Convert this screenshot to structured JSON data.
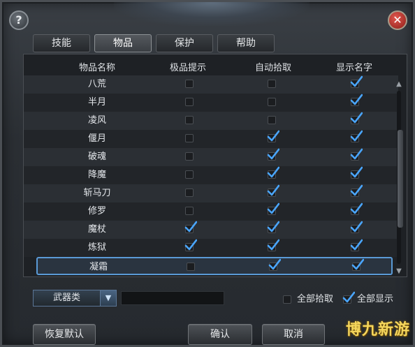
{
  "window": {
    "help_glyph": "?",
    "close_glyph": "✕"
  },
  "tabs": [
    {
      "label": "技能",
      "active": false
    },
    {
      "label": "物品",
      "active": true
    },
    {
      "label": "保护",
      "active": false
    },
    {
      "label": "帮助",
      "active": false
    }
  ],
  "table": {
    "columns": [
      "物品名称",
      "极品提示",
      "自动拾取",
      "显示名字"
    ],
    "rows": [
      {
        "name": "八荒",
        "premium_hint": false,
        "auto_pickup": false,
        "show_name": true
      },
      {
        "name": "半月",
        "premium_hint": false,
        "auto_pickup": false,
        "show_name": true
      },
      {
        "name": "凌风",
        "premium_hint": false,
        "auto_pickup": false,
        "show_name": true
      },
      {
        "name": "偃月",
        "premium_hint": false,
        "auto_pickup": true,
        "show_name": true
      },
      {
        "name": "破魂",
        "premium_hint": false,
        "auto_pickup": true,
        "show_name": true
      },
      {
        "name": "降魔",
        "premium_hint": false,
        "auto_pickup": true,
        "show_name": true
      },
      {
        "name": "斩马刀",
        "premium_hint": false,
        "auto_pickup": true,
        "show_name": true
      },
      {
        "name": "修罗",
        "premium_hint": false,
        "auto_pickup": true,
        "show_name": true
      },
      {
        "name": "魔杖",
        "premium_hint": true,
        "auto_pickup": true,
        "show_name": true
      },
      {
        "name": "炼狱",
        "premium_hint": true,
        "auto_pickup": true,
        "show_name": true
      },
      {
        "name": "凝霜",
        "premium_hint": false,
        "auto_pickup": true,
        "show_name": true,
        "selected": true
      }
    ]
  },
  "filter": {
    "category_value": "武器类",
    "arrow_glyph": "▼",
    "search_value": ""
  },
  "bulk": {
    "all_pickup_label": "全部拾取",
    "all_pickup_checked": false,
    "all_show_label": "全部显示",
    "all_show_checked": true
  },
  "buttons": {
    "restore_label": "恢复默认",
    "confirm_label": "确认",
    "cancel_label": "取消"
  },
  "scroll": {
    "up_glyph": "▲",
    "down_glyph": "▼"
  },
  "watermark": "博九新游",
  "colors": {
    "check_blue": "#4aa6ff"
  }
}
